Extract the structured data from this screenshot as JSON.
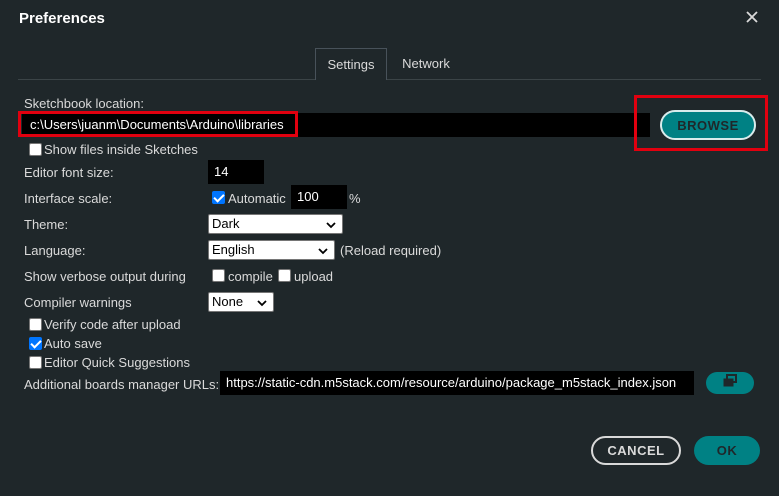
{
  "dialog": {
    "title": "Preferences"
  },
  "tabs": [
    {
      "label": "Settings",
      "active": true
    },
    {
      "label": "Network",
      "active": false
    }
  ],
  "sketchbook": {
    "label": "Sketchbook location:",
    "value": "c:\\Users\\juanm\\Documents\\Arduino\\libraries",
    "browse_label": "BROWSE"
  },
  "show_files": {
    "label": "Show files inside Sketches",
    "checked": false
  },
  "editor_font_size": {
    "label": "Editor font size:",
    "value": "14"
  },
  "interface_scale": {
    "label": "Interface scale:",
    "automatic_label": "Automatic",
    "automatic_checked": true,
    "value": "100",
    "unit": "%"
  },
  "theme": {
    "label": "Theme:",
    "value": "Dark"
  },
  "language": {
    "label": "Language:",
    "value": "English",
    "note": "(Reload required)"
  },
  "verbose": {
    "label": "Show verbose output during",
    "compile_label": "compile",
    "compile_checked": false,
    "upload_label": "upload",
    "upload_checked": false
  },
  "compiler_warnings": {
    "label": "Compiler warnings",
    "value": "None"
  },
  "verify_after_upload": {
    "label": "Verify code after upload",
    "checked": false
  },
  "auto_save": {
    "label": "Auto save",
    "checked": true
  },
  "quick_suggestions": {
    "label": "Editor Quick Suggestions",
    "checked": false
  },
  "boards_urls": {
    "label": "Additional boards manager URLs:",
    "value": "https://static-cdn.m5stack.com/resource/arduino/package_m5stack_index.json"
  },
  "buttons": {
    "cancel": "CANCEL",
    "ok": "OK"
  },
  "colors": {
    "background": "#1f272a",
    "accent_teal": "#008184",
    "highlight_red": "#e1000f",
    "field_black": "#000000",
    "checkbox_blue": "#0075ff"
  },
  "icons": {
    "close": "close-icon",
    "chevron": "chevron-down-icon",
    "open_url_editor": "open-window-icon",
    "check": "checkmark-icon"
  }
}
